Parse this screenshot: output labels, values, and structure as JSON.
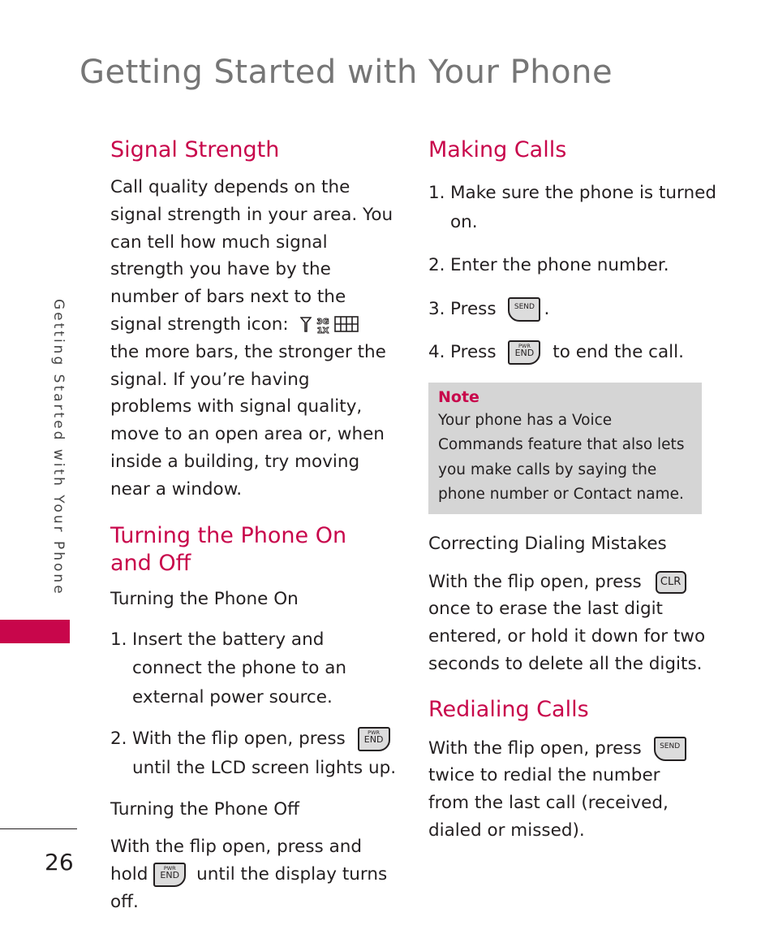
{
  "page": {
    "title": "Getting Started with Your Phone",
    "side_tab": "Getting Started with Your Phone",
    "page_number": "26",
    "accent_color": "#c8064b"
  },
  "left": {
    "signal": {
      "heading": "Signal Strength",
      "body_before_icons": "Call quality depends on the signal strength in your area. You can tell how much signal strength you have by the number of bars next to the signal strength icon:",
      "icons": [
        "antenna-icon",
        "3g-1x-icon",
        "signal-bars-icon"
      ],
      "body_after_icons": "the more bars, the stronger the signal. If you’re having problems with signal quality, move to an open area or, when inside a building, try moving near a window."
    },
    "power": {
      "heading": "Turning the Phone On and Off",
      "on_heading": "Turning the Phone On",
      "on_steps": [
        {
          "num": "1.",
          "text": "Insert the battery and connect the phone to an external power source."
        },
        {
          "num": "2.",
          "before": "With the flip open, press",
          "key": "end",
          "after": "until the LCD screen lights up."
        }
      ],
      "off_heading": "Turning the Phone Off",
      "off_before": "With the flip open, press and hold",
      "off_after": "until the display turns off."
    }
  },
  "right": {
    "making": {
      "heading": "Making Calls",
      "steps": [
        {
          "num": "1.",
          "text": "Make sure the phone is turned on."
        },
        {
          "num": "2.",
          "text": "Enter the phone number."
        },
        {
          "num": "3.",
          "before": "Press",
          "after": "."
        },
        {
          "num": "4.",
          "before": "Press",
          "after": "to end the call."
        }
      ]
    },
    "note": {
      "title": "Note",
      "body": "Your phone has a Voice Commands feature that also lets you make calls by saying the phone number or Contact name."
    },
    "correcting": {
      "heading": "Correcting Dialing Mistakes",
      "before": "With the flip open, press",
      "after": "once to erase the last digit entered, or hold it down for two seconds to delete all the digits."
    },
    "redial": {
      "heading": "Redialing Calls",
      "before": "With the flip open, press",
      "after": "twice to redial the number from the last call (received, dialed or missed)."
    }
  },
  "keys": {
    "send": "SEND",
    "end": "END",
    "pwr": "PWR",
    "clr": "CLR"
  }
}
